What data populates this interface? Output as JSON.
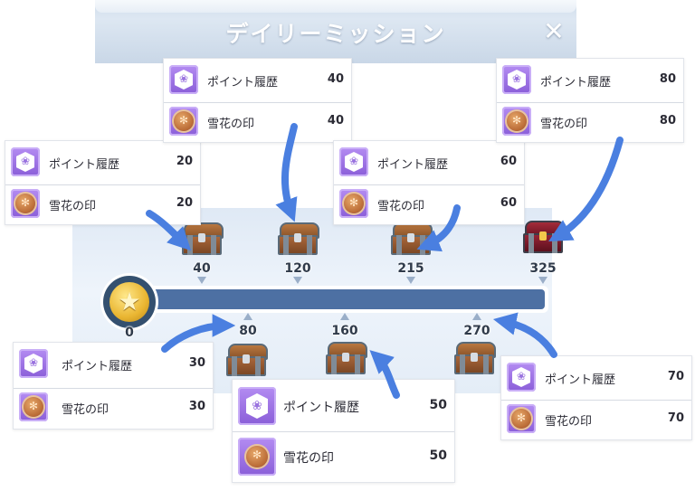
{
  "header": {
    "title": "デイリーミッション",
    "close_icon": "✕"
  },
  "progress": {
    "start_value": "0",
    "upper_milestones": [
      "40",
      "120",
      "215",
      "325"
    ],
    "lower_milestones": [
      "80",
      "160",
      "270"
    ]
  },
  "rewards": {
    "r20": {
      "point_label": "ポイント履歴",
      "point_qty": "20",
      "seal_label": "雪花の印",
      "seal_qty": "20"
    },
    "r30": {
      "point_label": "ポイント履歴",
      "point_qty": "30",
      "seal_label": "雪花の印",
      "seal_qty": "30"
    },
    "r40": {
      "point_label": "ポイント履歴",
      "point_qty": "40",
      "seal_label": "雪花の印",
      "seal_qty": "40"
    },
    "r50": {
      "point_label": "ポイント履歴",
      "point_qty": "50",
      "seal_label": "雪花の印",
      "seal_qty": "50"
    },
    "r60": {
      "point_label": "ポイント履歴",
      "point_qty": "60",
      "seal_label": "雪花の印",
      "seal_qty": "60"
    },
    "r70": {
      "point_label": "ポイント履歴",
      "point_qty": "70",
      "seal_label": "雪花の印",
      "seal_qty": "70"
    },
    "r80": {
      "point_label": "ポイント履歴",
      "point_qty": "80",
      "seal_label": "雪花の印",
      "seal_qty": "80"
    }
  },
  "colors": {
    "bar": "#4d70a3",
    "arrow": "#4a7fe0",
    "icon_purple": "#8a5ed8"
  }
}
